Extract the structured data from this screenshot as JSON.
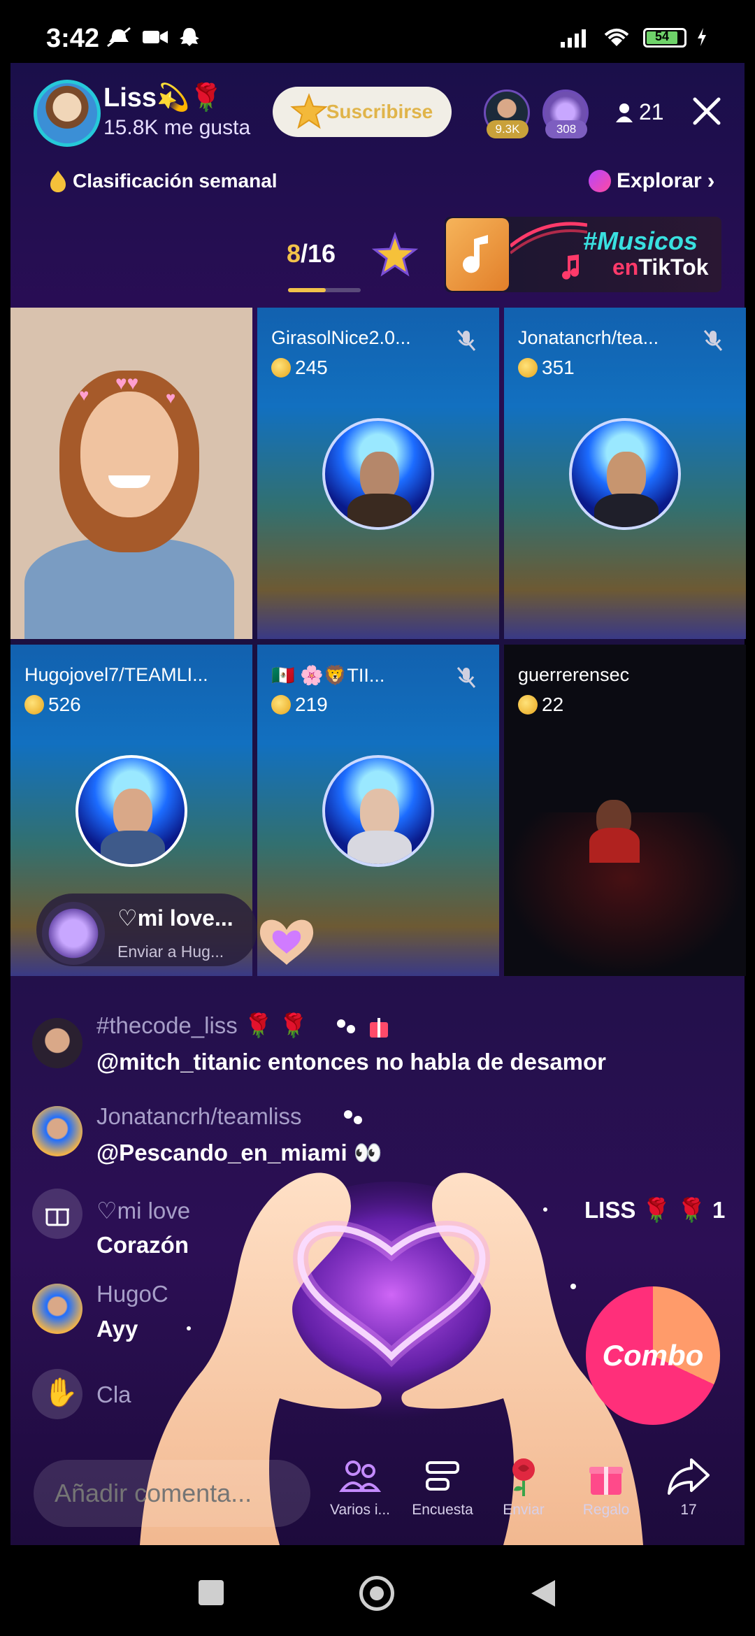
{
  "status_bar": {
    "time": "3:42",
    "battery": "54"
  },
  "header": {
    "host_name": "Liss💫🌹",
    "host_likes": "15.8K me gusta",
    "subscribe_label": "Suscribirse",
    "viewers": [
      {
        "badge": "9.3K"
      },
      {
        "badge": "308"
      }
    ],
    "viewer_count": "21",
    "weekly_rank_label": "Clasificación semanal",
    "explore_label": "Explorar"
  },
  "carousel": {
    "current": "8",
    "total": "/16",
    "promo_line1": "#Musicos",
    "promo_en": "en",
    "promo_line2": "TikTok"
  },
  "guests": [
    {
      "name": "GirasolNice2.0...",
      "coins": "245"
    },
    {
      "name": "Jonatancrh/tea...",
      "coins": "351"
    },
    {
      "name": "Hugojovel7/TEAMLI...",
      "coins": "526"
    },
    {
      "name": "🇲🇽 🌸🦁TII...",
      "coins": "219"
    },
    {
      "name": "guerrerensec",
      "coins": "22"
    }
  ],
  "gift_overlay": {
    "title": "♡mi love...",
    "subtitle": "Enviar a Hug..."
  },
  "chat": [
    {
      "user": "#thecode_liss 🌹 🌹",
      "message": "@mitch_titanic entonces no habla de desamor"
    },
    {
      "user": "Jonatancrh/teamliss",
      "message": "@Pescando_en_miami 👀"
    },
    {
      "user": "♡mi love",
      "user_tail": "LISS 🌹 🌹 1",
      "message": "Corazón"
    },
    {
      "user": "HugoC",
      "message": "Ayy"
    },
    {
      "user": "Cla",
      "message": ""
    }
  ],
  "combo_label": "Combo",
  "bottom_bar": {
    "comment_placeholder": "Añadir comenta...",
    "items": [
      {
        "label": "Varios i..."
      },
      {
        "label": "Encuesta"
      },
      {
        "label": "Enviar"
      },
      {
        "label": "Regalo"
      },
      {
        "label": "17"
      }
    ]
  },
  "colors": {
    "accent": "#f2c24a",
    "combo": "#ff2f7a",
    "teal": "#39e0e0"
  }
}
